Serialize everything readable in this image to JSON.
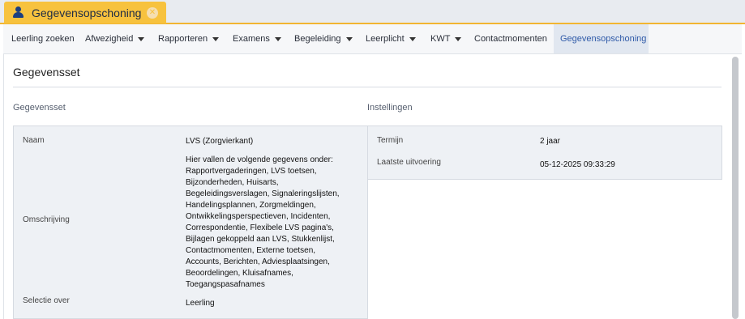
{
  "tab": {
    "title": "Gegevensopschoning"
  },
  "menu": [
    {
      "label": "Leerling zoeken",
      "caret": false
    },
    {
      "label": "Afwezigheid",
      "caret": true
    },
    {
      "label": "Rapporteren",
      "caret": true
    },
    {
      "label": "Examens",
      "caret": true
    },
    {
      "label": "Begeleiding",
      "caret": true
    },
    {
      "label": "Leerplicht",
      "caret": true
    },
    {
      "label": "KWT",
      "caret": true
    },
    {
      "label": "Contactmomenten",
      "caret": false
    },
    {
      "label": "Gegevensopschoning",
      "caret": false,
      "active": true
    }
  ],
  "page": {
    "title": "Gegevensset",
    "left_heading": "Gegevensset",
    "right_heading": "Instellingen"
  },
  "dataset": {
    "name_label": "Naam",
    "name_value": "LVS (Zorgvierkant)",
    "description_label": "Omschrijving",
    "description_lines": [
      "Hier vallen de volgende gegevens onder:",
      "Rapportvergaderingen, LVS toetsen,",
      "Bijzonderheden, Huisarts,",
      "Begeleidingsverslagen, Signaleringslijsten,",
      "Handelingsplannen, Zorgmeldingen,",
      "Ontwikkelingsperspectieven, Incidenten,",
      "Correspondentie, Flexibele LVS pagina's,",
      "Bijlagen gekoppeld aan LVS, Stukkenlijst,",
      "Contactmomenten, Externe toetsen,",
      "Accounts, Berichten, Adviesplaatsingen,",
      "Beoordelingen, Kluisafnames,",
      "Toegangspasafnames"
    ],
    "selection_label": "Selectie over",
    "selection_value": "Leerling"
  },
  "settings": {
    "term_label": "Termijn",
    "term_value": "2 jaar",
    "last_run_label": "Laatste uitvoering",
    "last_run_value": "05-12-2025 09:33:29"
  },
  "colors": {
    "tab_accent": "#f7c23e",
    "active_menu_text": "#2f5aa8",
    "panel_bg": "#eef1f5"
  }
}
